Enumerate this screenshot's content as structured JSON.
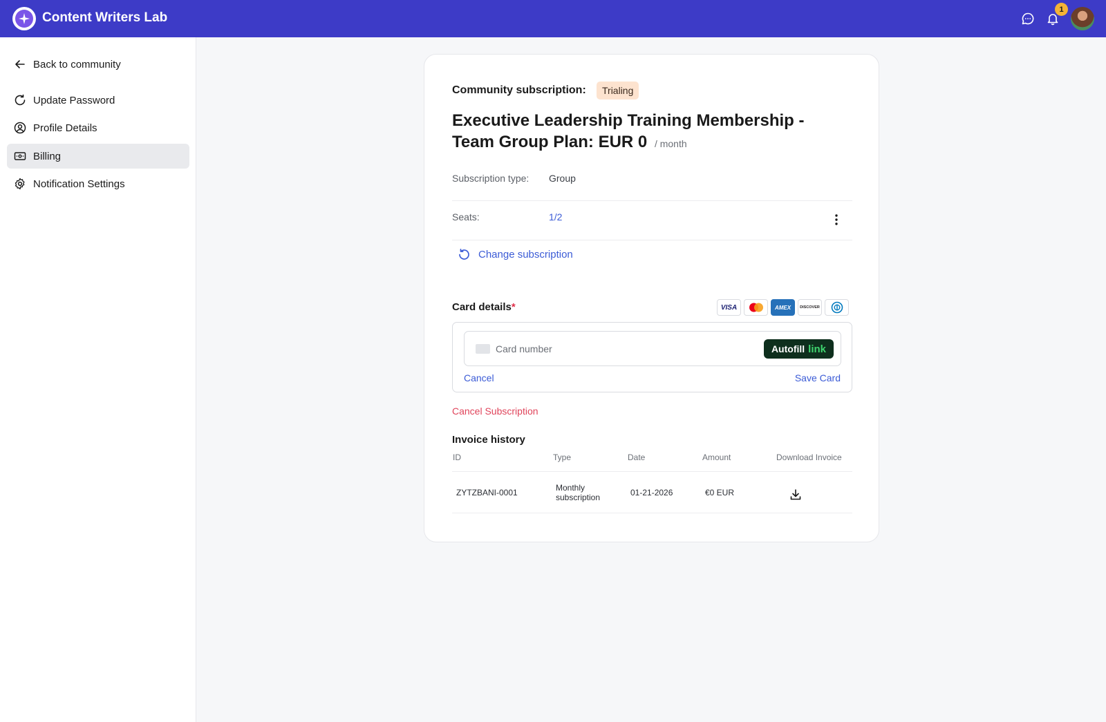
{
  "app": {
    "title": "Content Writers Lab",
    "notification_count": "1",
    "icons": [
      "chat-icon",
      "bell-icon"
    ]
  },
  "sidebar": {
    "back_label": "Back to community",
    "items": [
      {
        "label": "Update Password",
        "icon": "refresh-icon"
      },
      {
        "label": "Profile Details",
        "icon": "user-circle-icon"
      },
      {
        "label": "Billing",
        "icon": "billing-icon",
        "active": true
      },
      {
        "label": "Notification Settings",
        "icon": "gear-icon"
      }
    ]
  },
  "subscription": {
    "label": "Community subscription:",
    "status": "Trialing",
    "plan_title": "Executive Leadership Training Membership - Team Group Plan: EUR 0",
    "period": "/ month",
    "type_label": "Subscription type:",
    "type_value": "Group",
    "seats_label": "Seats:",
    "seats_value": "1/2",
    "change_label": "Change subscription"
  },
  "card": {
    "label": "Card details",
    "required_mark": "*",
    "brands": [
      "VISA",
      "Mastercard",
      "AMEX",
      "DISCOVER",
      "Diners"
    ],
    "placeholder": "Card number",
    "autofill_label": "Autofill",
    "autofill_link": "link",
    "cancel_label": "Cancel",
    "save_label": "Save Card"
  },
  "cancel_subscription_label": "Cancel Subscription",
  "invoices": {
    "title": "Invoice history",
    "columns": [
      "ID",
      "Type",
      "Date",
      "Amount",
      "Download Invoice"
    ],
    "rows": [
      {
        "id": "ZYTZBANI-0001",
        "type_line1": "Monthly",
        "type_line2": "subscription",
        "date": "01-21-2026",
        "amount": "€0 EUR"
      }
    ]
  },
  "colors": {
    "topbar": "#3d3bc7",
    "link": "#3b5bd6",
    "danger": "#e0445b",
    "badge_bg": "#fde3cf"
  }
}
